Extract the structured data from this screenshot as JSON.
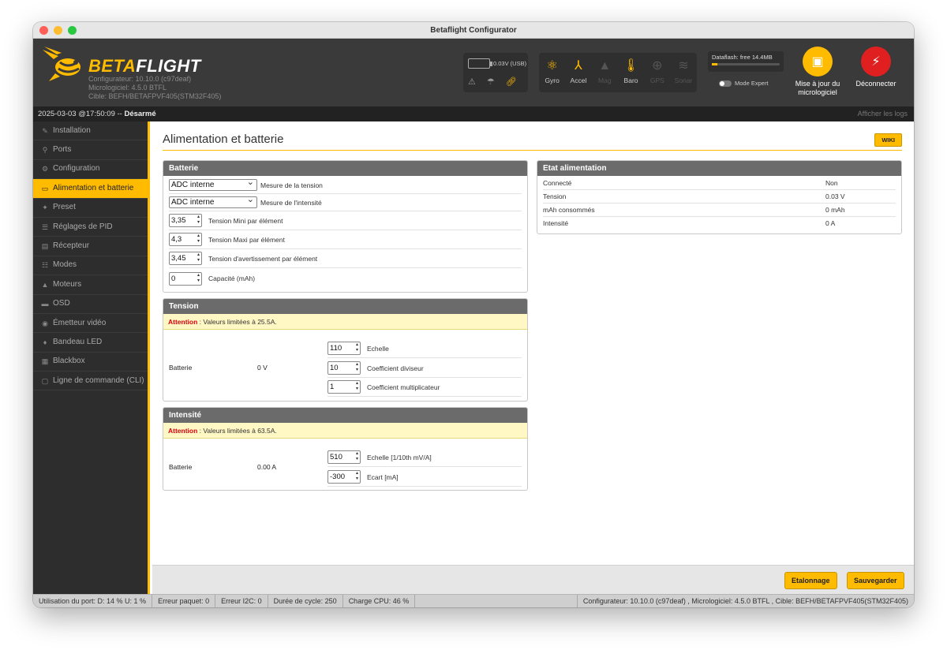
{
  "window": {
    "title": "Betaflight Configurator"
  },
  "header": {
    "brand_a": "BETA",
    "brand_b": "FLIGHT",
    "info_line1": "Configurateur: 10.10.0 (c97deaf)",
    "info_line2": "Micrologiciel: 4.5.0 BTFL",
    "info_line3": "Cible: BEFH/BETAFPVF405(STM32F405)",
    "voltage": "0.03V (USB)",
    "sensors": [
      {
        "label": "Gyro",
        "icon": "gyro-icon",
        "active": true
      },
      {
        "label": "Accel",
        "icon": "accel-icon",
        "active": true
      },
      {
        "label": "Mag",
        "icon": "mag-icon",
        "active": false
      },
      {
        "label": "Baro",
        "icon": "thermometer-icon",
        "active": true
      },
      {
        "label": "GPS",
        "icon": "gps-icon",
        "active": false
      },
      {
        "label": "Sonar",
        "icon": "sonar-icon",
        "active": false
      }
    ],
    "dataflash": "Dataflash: free 14.4MB",
    "expert_mode": "Mode Expert",
    "firmware_update": "Mise à jour du micrologiciel",
    "disconnect": "Déconnecter"
  },
  "statusline": {
    "datetime": "2025-03-03 @17:50:09 -- ",
    "state": "Désarmé",
    "show_logs": "Afficher les logs"
  },
  "sidebar": {
    "items": [
      {
        "label": "Installation",
        "icon": "wrench-icon"
      },
      {
        "label": "Ports",
        "icon": "plug-icon"
      },
      {
        "label": "Configuration",
        "icon": "gear-icon"
      },
      {
        "label": "Alimentation et batterie",
        "icon": "battery-icon",
        "active": true
      },
      {
        "label": "Preset",
        "icon": "preset-icon"
      },
      {
        "label": "Réglages de PID",
        "icon": "sliders-icon"
      },
      {
        "label": "Récepteur",
        "icon": "receiver-icon"
      },
      {
        "label": "Modes",
        "icon": "modes-icon"
      },
      {
        "label": "Moteurs",
        "icon": "motor-icon"
      },
      {
        "label": "OSD",
        "icon": "osd-icon"
      },
      {
        "label": "Émetteur vidéo",
        "icon": "antenna-icon"
      },
      {
        "label": "Bandeau LED",
        "icon": "led-icon"
      },
      {
        "label": "Blackbox",
        "icon": "blackbox-icon"
      },
      {
        "label": "Ligne de commande (CLI)",
        "icon": "terminal-icon"
      }
    ]
  },
  "page": {
    "title": "Alimentation et batterie",
    "wiki": "WIKI"
  },
  "battery_panel": {
    "title": "Batterie",
    "voltage_meter": {
      "value": "ADC interne",
      "label": "Mesure de la tension"
    },
    "current_meter": {
      "value": "ADC interne",
      "label": "Mesure de l'intensité"
    },
    "min_cell": {
      "value": "3,35",
      "label": "Tension Mini par élément"
    },
    "max_cell": {
      "value": "4,3",
      "label": "Tension Maxi par élément"
    },
    "warn_cell": {
      "value": "3,45",
      "label": "Tension d'avertissement par élément"
    },
    "capacity": {
      "value": "0",
      "label": "Capacité (mAh)"
    }
  },
  "voltage_panel": {
    "title": "Tension",
    "warn_prefix": "Attention",
    "warn_text": " : Valeurs limitées à 25.5A.",
    "row_label": "Batterie",
    "row_value": "0 V",
    "scale": {
      "value": "110",
      "label": "Echelle"
    },
    "divider": {
      "value": "10",
      "label": "Coefficient diviseur"
    },
    "multiplier": {
      "value": "1",
      "label": "Coefficient multiplicateur"
    }
  },
  "current_panel": {
    "title": "Intensité",
    "warn_prefix": "Attention",
    "warn_text": " : Valeurs limitées à 63.5A.",
    "row_label": "Batterie",
    "row_value": "0.00 A",
    "scale": {
      "value": "510",
      "label": "Echelle [1/10th mV/A]"
    },
    "offset": {
      "value": "-300",
      "label": "Ecart [mA]"
    }
  },
  "power_state": {
    "title": "Etat alimentation",
    "rows": [
      {
        "label": "Connecté",
        "value": "Non"
      },
      {
        "label": "Tension",
        "value": "0.03 V"
      },
      {
        "label": "mAh consommés",
        "value": "0 mAh"
      },
      {
        "label": "Intensité",
        "value": "0 A"
      }
    ]
  },
  "footer": {
    "calibration": "Etalonnage",
    "save": "Sauvegarder"
  },
  "bottombar": {
    "port": "Utilisation du port: D: 14 % U: 1 %",
    "packet_error": "Erreur paquet: 0",
    "i2c_error": "Erreur I2C: 0",
    "cycle": "Durée de cycle: 250",
    "cpu": "Charge CPU: 46 %",
    "version": "Configurateur: 10.10.0 (c97deaf) , Micrologiciel: 4.5.0 BTFL , Cible: BEFH/BETAFPVF405(STM32F405)"
  }
}
